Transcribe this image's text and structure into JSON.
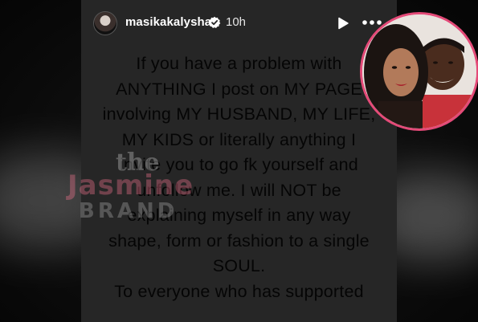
{
  "header": {
    "username": "masikakalysha",
    "time": "10h",
    "verified_icon": "verified-badge-icon",
    "play_icon": "play-icon",
    "more_icon": "more-options-icon"
  },
  "story": {
    "background_color": "#262626",
    "text": "If you have a problem with\nANYTHING I post on MY PAGE\ninvolving MY HUSBAND, MY LIFE,\nMY KIDS or literally anything I\ninvite you to go fk yourself and\nunfollow me. I will NOT be\nexplaining myself in any way\nshape, form or fashion to a single\nSOUL.\nTo everyone who has supported"
  },
  "watermark": {
    "line1": "the",
    "line2": "Jasmine",
    "line3": "BRAND"
  },
  "inset_photo": {
    "border_color": "#e44a78"
  }
}
